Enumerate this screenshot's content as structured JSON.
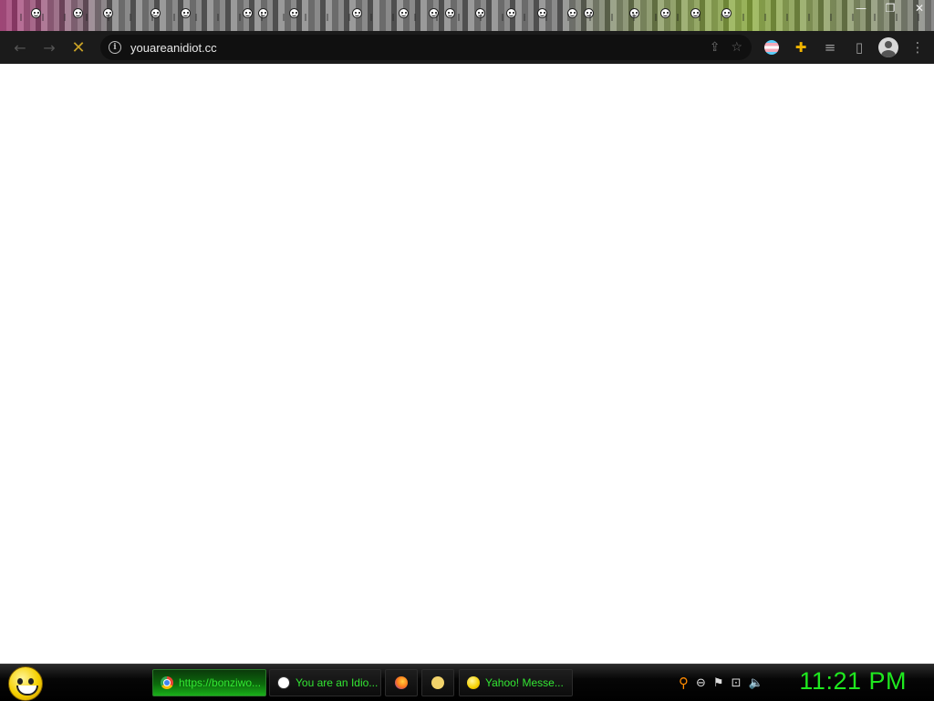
{
  "window": {
    "controls": [
      "—",
      "❐",
      "✕"
    ]
  },
  "toolbar": {
    "back_icon": "←",
    "forward_icon": "→",
    "stop_icon": "✕",
    "url": "youareanidiot.cc",
    "share_icon": "⇪",
    "bookmark_icon": "☆",
    "puzzle_icon": "✚",
    "media_icon": "≡",
    "sidepanel_icon": "▯",
    "menu_icon": "⋮"
  },
  "taskbar": {
    "tasks": [
      {
        "label": "https://bonziwo...",
        "icon": "chrome-icon",
        "active": true
      },
      {
        "label": "You are an Idio...",
        "icon": "smiley-icon",
        "active": false
      },
      {
        "label": "",
        "icon": "firefox-icon",
        "active": false
      },
      {
        "label": "",
        "icon": "folder-icon",
        "active": false
      },
      {
        "label": "Yahoo! Messe...",
        "icon": "yahoo-icon",
        "active": false
      }
    ],
    "tray": {
      "search": "⚲",
      "status": "⊖",
      "flag": "⚑",
      "network": "⊡",
      "volume": "🔈"
    },
    "clock": "11:21 PM"
  },
  "colors": {
    "clock": "#1fe81f",
    "task_text": "#32e632",
    "stop_icon": "#c9a227",
    "page_bg": "#ffffff"
  }
}
